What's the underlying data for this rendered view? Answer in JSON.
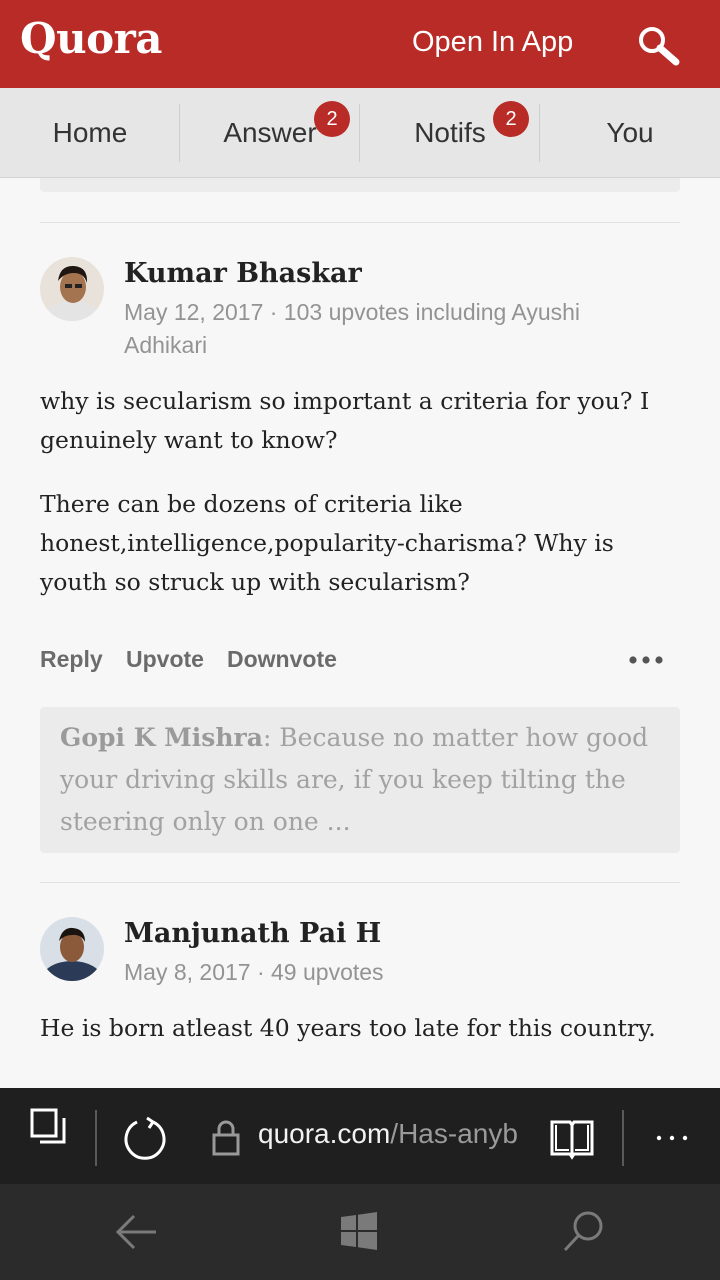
{
  "header": {
    "logo": "Quora",
    "open_app": "Open In App",
    "search_icon": "search-icon"
  },
  "nav": {
    "items": [
      {
        "label": "Home"
      },
      {
        "label": "Answer",
        "badge": "2"
      },
      {
        "label": "Notifs",
        "badge": "2"
      },
      {
        "label": "You"
      }
    ]
  },
  "comments": [
    {
      "author": "Kumar Bhaskar",
      "meta_line1": "May 12, 2017 · 103 upvotes including Ayushi",
      "meta_line2": "Adhikari",
      "paragraphs": [
        "why is secularism so important a criteria for you? I genuinely want to know?",
        "There can be dozens of criteria like honest,intelligence,popularity-charisma? Why is youth so struck up with secularism?"
      ],
      "actions": {
        "reply": "Reply",
        "upvote": "Upvote",
        "downvote": "Downvote"
      },
      "reply_preview": {
        "author": "Gopi K Mishra",
        "text": ": Because no matter how good your driving skills are, if you keep tilting the steering only on one ..."
      }
    },
    {
      "author": "Manjunath Pai H",
      "meta": "May 8, 2017 · 49 upvotes",
      "paragraphs": [
        "He is born atleast 40 years too late for this country."
      ]
    }
  ],
  "browser": {
    "url_domain": "quora.com",
    "url_path": "/Has-anyb"
  },
  "colors": {
    "brand": "#b92b27",
    "background": "#f7f7f7",
    "browser_bar": "#1f1f1f",
    "system_nav": "#2b2b2b"
  }
}
